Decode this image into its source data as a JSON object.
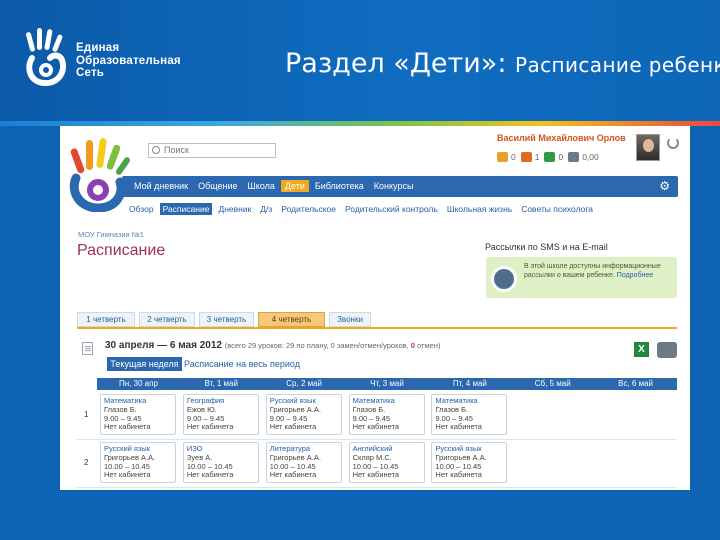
{
  "slide": {
    "logo_lines": [
      "Единая",
      "Образовательная",
      "Сеть"
    ],
    "title_main": "Раздел «Дети»:",
    "title_sub": "Расписание ребенка"
  },
  "screen": {
    "search_placeholder": "Поиск",
    "user_name": "Василий Михайлович Орлов",
    "counters": [
      {
        "icon": "message-icon",
        "color": "#e7a12a",
        "value": "0"
      },
      {
        "icon": "friends-icon",
        "color": "#e06a1e",
        "value": "1"
      },
      {
        "icon": "groups-icon",
        "color": "#2f9a4a",
        "value": "0"
      },
      {
        "icon": "wallet-icon",
        "color": "#6a7a8a",
        "value": "0,00"
      }
    ],
    "nav": [
      "Мой дневник",
      "Общение",
      "Школа",
      "Дети",
      "Библиотека",
      "Конкурсы"
    ],
    "nav_active": "Дети",
    "subnav": [
      "Обзор",
      "Расписание",
      "Дневник",
      "Д/з",
      "Родительское",
      "Родительский контроль",
      "Школьная жизнь",
      "Советы психолога"
    ],
    "subnav_active": "Расписание",
    "breadcrumb": "МОУ Гимназия №1",
    "page_title": "Расписание",
    "notify_title": "Рассылки по SMS и на E-mail",
    "notify_text": "В этой школе доступны информационные рассылки о вашем ребенке.",
    "notify_link": "Подробнее",
    "tabs": [
      "1 четверть",
      "2 четверть",
      "3 четверть",
      "4 четверть",
      "Звонки"
    ],
    "tab_active": "4 четверть",
    "range_title": "30 апреля — 6 мая 2012",
    "range_note_a": "(всего 29 уроков: 29 по плану, 0 замен/отмен/уроков, ",
    "range_note_b": "0",
    "range_note_c": " отмен)",
    "btn_week": "Текущая неделя",
    "btn_all": "Расписание на весь период",
    "days": [
      "Пн, 30 апр",
      "Вт, 1 май",
      "Ср, 2 май",
      "Чт, 3 май",
      "Пт, 4 май",
      "Сб, 5 май",
      "Вс, 6 май"
    ],
    "rows": [
      {
        "num": "1",
        "lessons": [
          {
            "subj": "Математика",
            "teacher": "Глазов Б.",
            "time": "9.00 – 9.45",
            "room": "Нет кабинета"
          },
          {
            "subj": "География",
            "teacher": "Ежов Ю.",
            "time": "9.00 – 9.45",
            "room": "Нет кабинета"
          },
          {
            "subj": "Русский язык",
            "teacher": "Григорьев А.А.",
            "time": "9.00 – 9.45",
            "room": "Нет кабинета"
          },
          {
            "subj": "Математика",
            "teacher": "Глазов Б.",
            "time": "9.00 – 9.45",
            "room": "Нет кабинета"
          },
          {
            "subj": "Математика",
            "teacher": "Глазов Б.",
            "time": "9.00 – 9.45",
            "room": "Нет кабинета"
          }
        ]
      },
      {
        "num": "2",
        "lessons": [
          {
            "subj": "Русский язык",
            "teacher": "Григорьев А.А.",
            "time": "10.00 – 10.45",
            "room": "Нет кабинета"
          },
          {
            "subj": "ИЗО",
            "teacher": "Зуев А.",
            "time": "10.00 – 10.45",
            "room": "Нет кабинета"
          },
          {
            "subj": "Литература",
            "teacher": "Григорьев А.А.",
            "time": "10.00 – 10.45",
            "room": "Нет кабинета"
          },
          {
            "subj": "Английский",
            "teacher": "Скляр М.С.",
            "time": "10.00 – 10.45",
            "room": "Нет кабинета"
          },
          {
            "subj": "Русский язык",
            "teacher": "Григорьев А.А.",
            "time": "10.00 – 10.45",
            "room": "Нет кабинета"
          }
        ]
      }
    ]
  }
}
